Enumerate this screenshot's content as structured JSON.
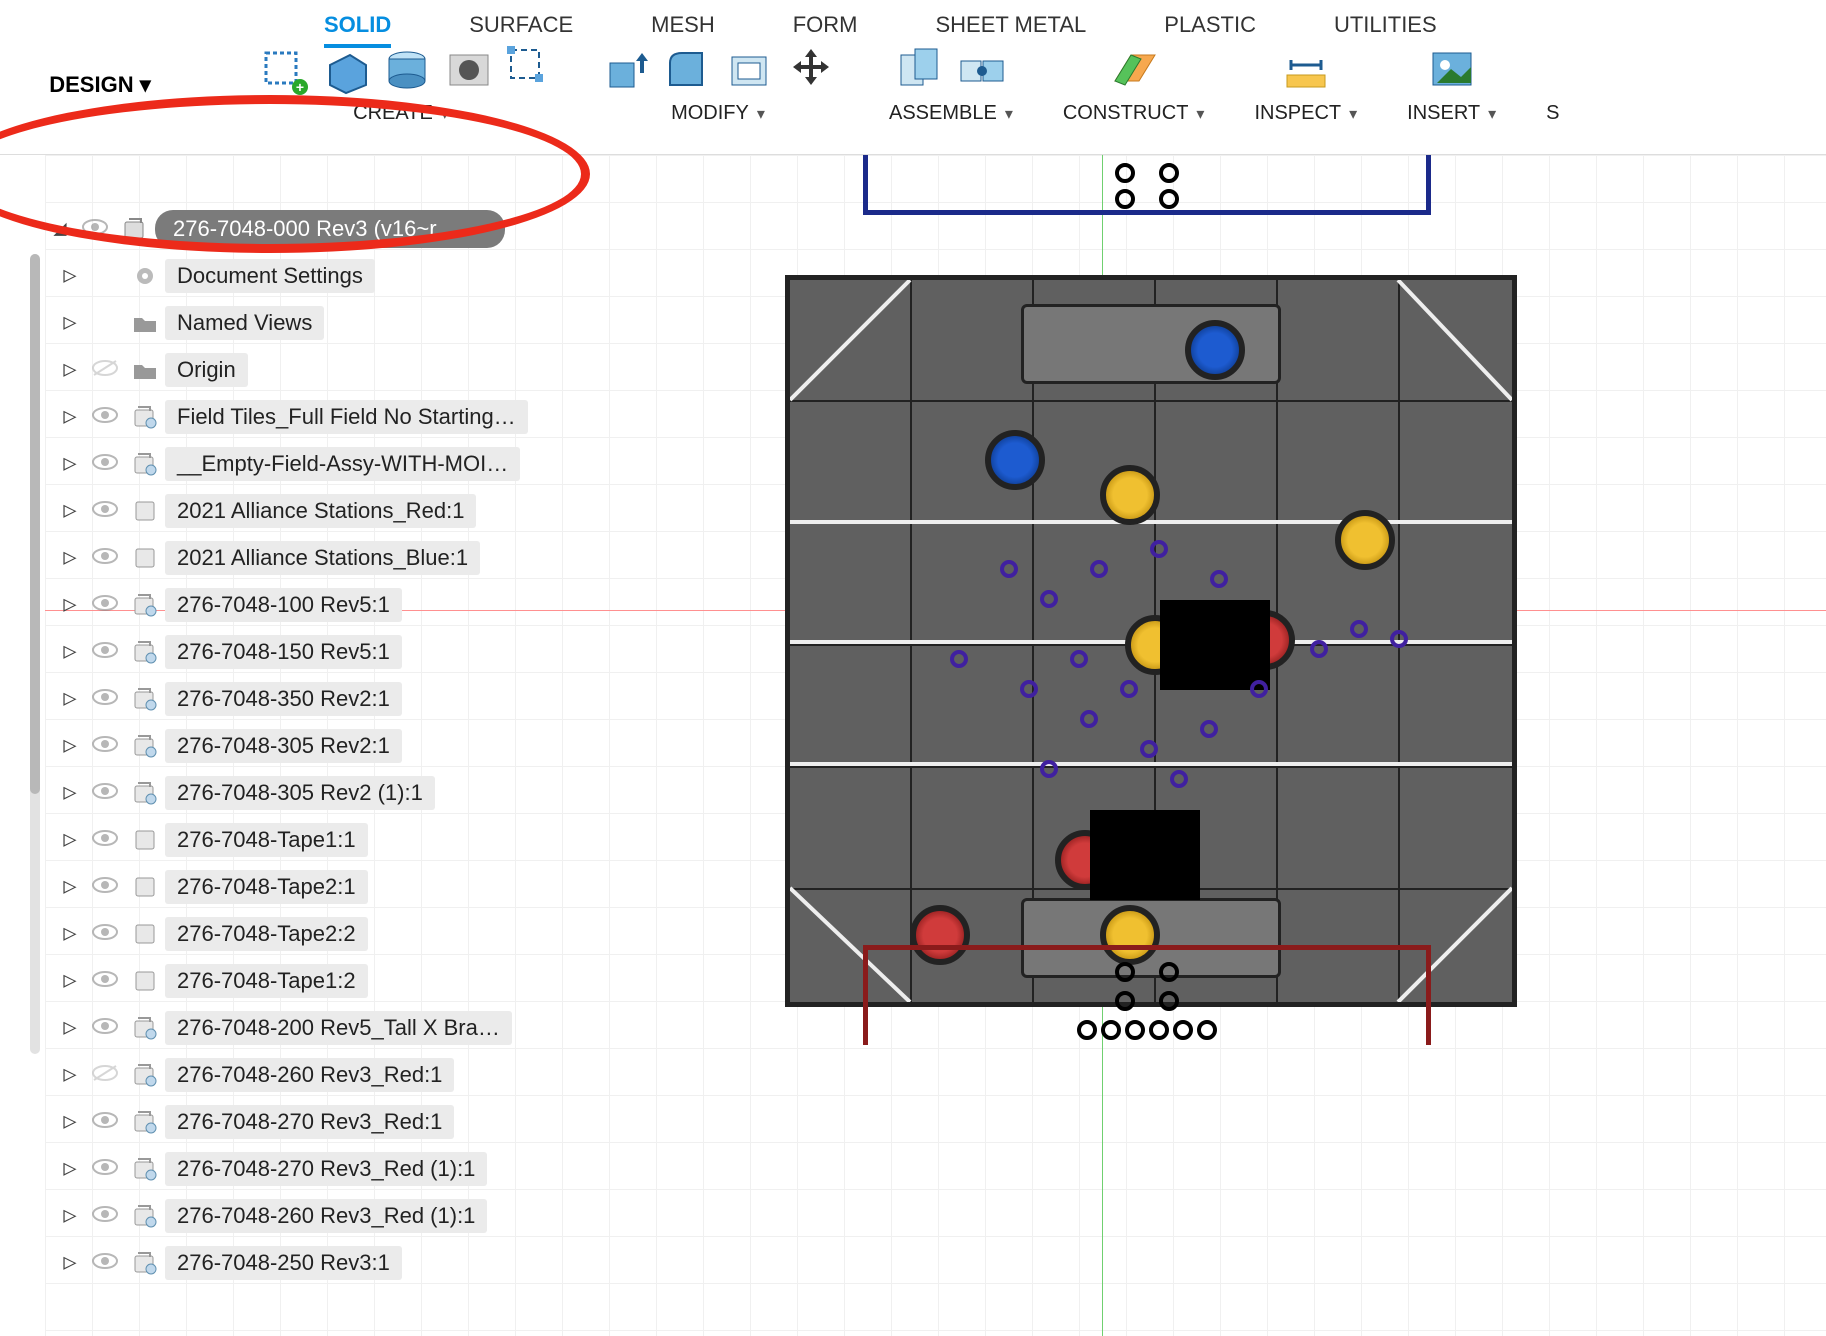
{
  "workspace_button": "DESIGN",
  "tabs": [
    "SOLID",
    "SURFACE",
    "MESH",
    "FORM",
    "SHEET METAL",
    "PLASTIC",
    "UTILITIES"
  ],
  "active_tab": "SOLID",
  "ribbon_groups": {
    "create": "CREATE",
    "modify": "MODIFY",
    "assemble": "ASSEMBLE",
    "construct": "CONSTRUCT",
    "inspect": "INSPECT",
    "insert": "INSERT"
  },
  "browser": {
    "root": "276-7048-000 Rev3 (v16~r…",
    "items": [
      {
        "icon": "gear",
        "vis": "none",
        "label": "Document Settings"
      },
      {
        "icon": "folder",
        "vis": "none",
        "label": "Named Views"
      },
      {
        "icon": "folder",
        "vis": "hidden",
        "label": "Origin"
      },
      {
        "icon": "linked",
        "vis": "shown",
        "label": "Field Tiles_Full Field No Starting…"
      },
      {
        "icon": "linked",
        "vis": "shown",
        "label": "__Empty-Field-Assy-WITH-MOI…"
      },
      {
        "icon": "component",
        "vis": "shown",
        "label": "2021 Alliance Stations_Red:1"
      },
      {
        "icon": "component",
        "vis": "shown",
        "label": "2021 Alliance Stations_Blue:1"
      },
      {
        "icon": "linked",
        "vis": "shown",
        "label": "276-7048-100 Rev5:1"
      },
      {
        "icon": "linked",
        "vis": "shown",
        "label": "276-7048-150 Rev5:1"
      },
      {
        "icon": "linked",
        "vis": "shown",
        "label": "276-7048-350 Rev2:1"
      },
      {
        "icon": "linked",
        "vis": "shown",
        "label": "276-7048-305 Rev2:1"
      },
      {
        "icon": "linked",
        "vis": "shown",
        "label": "276-7048-305 Rev2 (1):1"
      },
      {
        "icon": "component",
        "vis": "shown",
        "label": "276-7048-Tape1:1"
      },
      {
        "icon": "component",
        "vis": "shown",
        "label": "276-7048-Tape2:1"
      },
      {
        "icon": "component",
        "vis": "shown",
        "label": "276-7048-Tape2:2"
      },
      {
        "icon": "component",
        "vis": "shown",
        "label": "276-7048-Tape1:2"
      },
      {
        "icon": "linked",
        "vis": "shown",
        "label": "276-7048-200 Rev5_Tall X Bra…"
      },
      {
        "icon": "linked",
        "vis": "hidden",
        "label": "276-7048-260 Rev3_Red:1"
      },
      {
        "icon": "linked",
        "vis": "shown",
        "label": "276-7048-270 Rev3_Red:1"
      },
      {
        "icon": "linked",
        "vis": "shown",
        "label": "276-7048-270 Rev3_Red (1):1"
      },
      {
        "icon": "linked",
        "vis": "shown",
        "label": "276-7048-260 Rev3_Red (1):1"
      },
      {
        "icon": "linked",
        "vis": "shown",
        "label": "276-7048-250 Rev3:1"
      }
    ]
  }
}
